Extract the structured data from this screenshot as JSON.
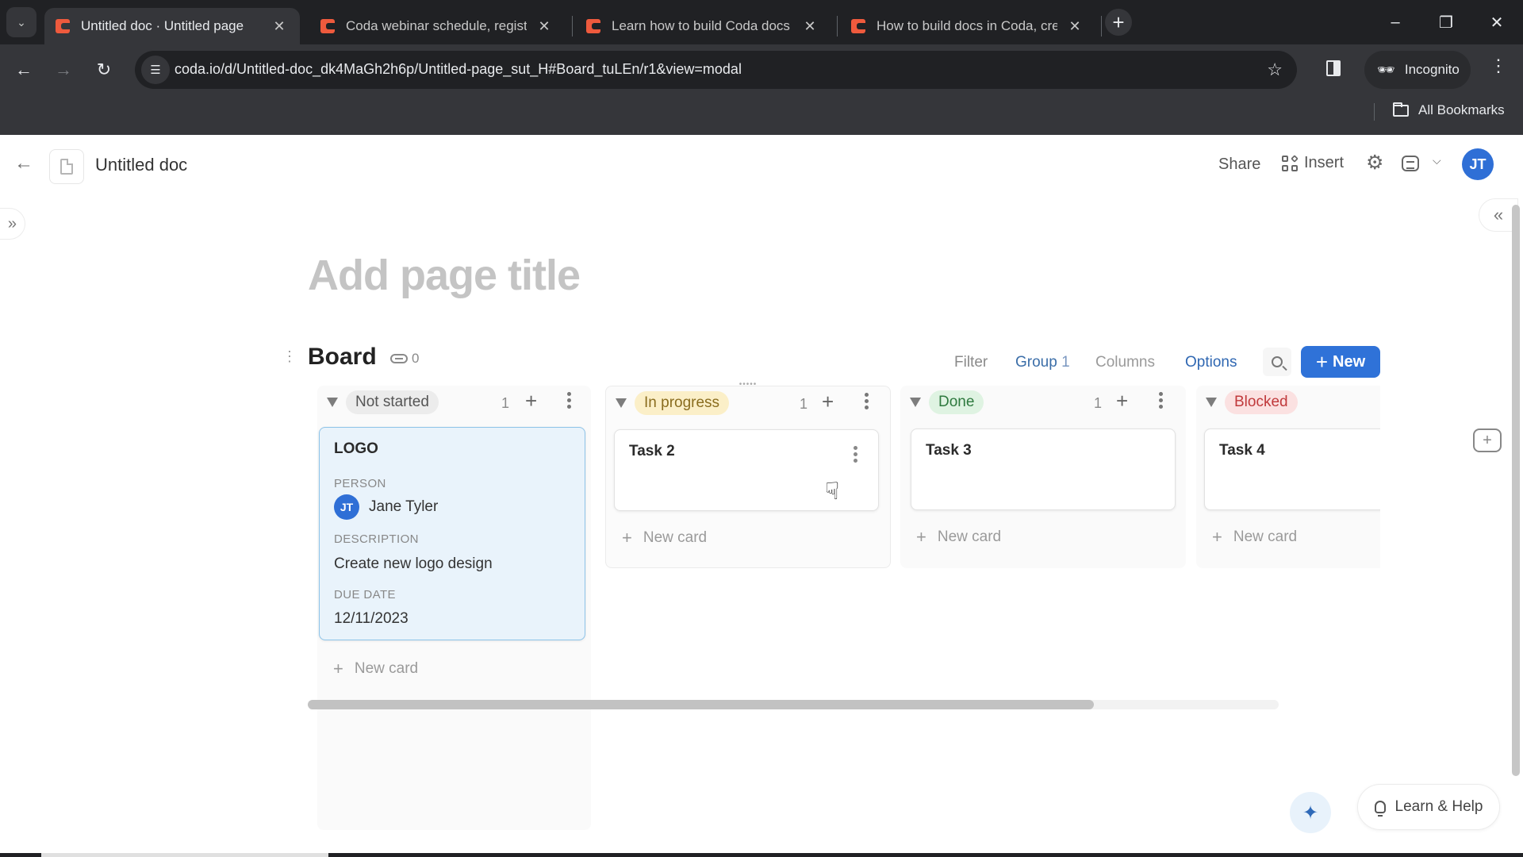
{
  "browser": {
    "tabs": [
      {
        "title": "Untitled doc · Untitled page",
        "active": true
      },
      {
        "title": "Coda webinar schedule, regist",
        "active": false
      },
      {
        "title": "Learn how to build Coda docs",
        "active": false
      },
      {
        "title": "How to build docs in Coda, cre",
        "active": false
      }
    ],
    "url": "coda.io/d/Untitled-doc_dk4MaGh2h6p/Untitled-page_sut_H#Board_tuLEn/r1&view=modal",
    "incognito_label": "Incognito",
    "all_bookmarks_label": "All Bookmarks",
    "icons": {
      "tab_search": "chevron-down-icon",
      "new_tab": "plus-icon",
      "back": "arrow-left-icon",
      "forward": "arrow-right-icon",
      "reload": "reload-icon",
      "site_info": "tune-icon",
      "bookmark": "star-icon",
      "side_panel": "side-panel-icon",
      "incognito": "incognito-icon",
      "menu": "kebab-icon",
      "folder": "folder-icon",
      "minimize": "minimize-icon",
      "restore": "restore-icon",
      "close": "close-icon"
    }
  },
  "doc": {
    "title": "Untitled doc",
    "share_label": "Share",
    "insert_label": "Insert",
    "avatar_initials": "JT",
    "page_title_placeholder": "Add page title"
  },
  "board": {
    "title": "Board",
    "link_count": "0",
    "controls": {
      "filter": "Filter",
      "group": "Group",
      "group_count": "1",
      "columns": "Columns",
      "options": "Options",
      "new_button": "New"
    },
    "new_card_label": "New card",
    "columns": [
      {
        "status": "Not started",
        "count": "1",
        "pill_bg": "#ececec",
        "pill_fg": "#555555",
        "cards": [
          {
            "title": "LOGO",
            "selected": true,
            "fields": {
              "person_label": "PERSON",
              "person_initials": "JT",
              "person_name": "Jane Tyler",
              "description_label": "DESCRIPTION",
              "description": "Create new logo design",
              "due_date_label": "DUE DATE",
              "due_date": "12/11/2023"
            }
          }
        ]
      },
      {
        "status": "In progress",
        "count": "1",
        "pill_bg": "#fbefc8",
        "pill_fg": "#8a6d1f",
        "cards": [
          {
            "title": "Task 2"
          }
        ]
      },
      {
        "status": "Done",
        "count": "1",
        "pill_bg": "#dff3e2",
        "pill_fg": "#2f7a3f",
        "cards": [
          {
            "title": "Task 3"
          }
        ]
      },
      {
        "status": "Blocked",
        "count": "",
        "pill_bg": "#fbe1e1",
        "pill_fg": "#c0393b",
        "cards": [
          {
            "title": "Task 4"
          }
        ]
      }
    ],
    "horizontal_scroll_fraction": 0.81
  },
  "footer": {
    "learn_help_label": "Learn & Help"
  },
  "colors": {
    "accent": "#2f72d8",
    "coda_brand": "#ee5a3d"
  }
}
